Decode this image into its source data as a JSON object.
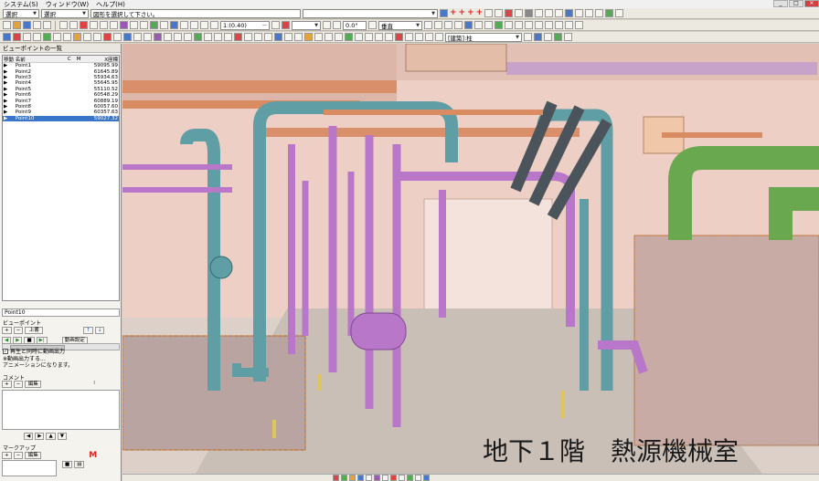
{
  "menu": {
    "items": [
      "システム(S)",
      "ウィンドウ(W)",
      "ヘルプ(H)"
    ]
  },
  "toolbar1": {
    "mode_select": "選択",
    "select_combo": "選択",
    "hint_text": "図形を選択して下さい。"
  },
  "toolbar2": {
    "scale_value": "1:(0.40)",
    "angle_value": "0.0°",
    "direction_value": "垂直"
  },
  "toolbar3": {
    "layer_value": "[建築]:柱"
  },
  "viewpoint_panel": {
    "title": "ビューポイントの一覧",
    "columns": [
      "移動",
      "名前",
      "C",
      "M",
      "X座標"
    ],
    "rows": [
      {
        "name": "Point1",
        "x": "59095.99"
      },
      {
        "name": "Point2",
        "x": "61645.89"
      },
      {
        "name": "Point3",
        "x": "55934.63"
      },
      {
        "name": "Point4",
        "x": "55645.95"
      },
      {
        "name": "Point5",
        "x": "55110.52"
      },
      {
        "name": "Point6",
        "x": "60548.29"
      },
      {
        "name": "Point7",
        "x": "60889.19"
      },
      {
        "name": "Point8",
        "x": "60057.60"
      },
      {
        "name": "Point9",
        "x": "60357.63"
      },
      {
        "name": "Point10",
        "x": "59027.32"
      }
    ],
    "current_name": "Point10",
    "section_viewpoint": "ビューポイント",
    "up_button": "上書",
    "anim_button": "動画設定",
    "checkbox_label": "再生と同時に動画出力",
    "note_line1": "※動画出力する...",
    "note_line2": "アニメーションになります。",
    "section_comment": "コメント",
    "edit_button": "編集",
    "section_markup": "マークアップ",
    "markup_edit_button": "編集",
    "markup_m": "M"
  },
  "caption": "地下１階　熱源機械室",
  "colors": {
    "selected_row": "#3874c8",
    "pipe_teal": "#5f9ea4",
    "pipe_purple": "#b877c9",
    "pipe_green": "#6aa84f",
    "duct_copper": "#d9906a",
    "wall_pink": "#eecfc6"
  }
}
